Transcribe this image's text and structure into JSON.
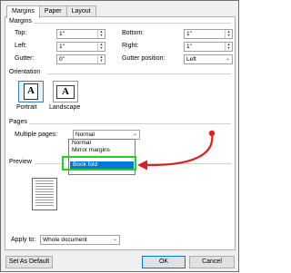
{
  "tabs": [
    {
      "label": "Margins",
      "active": true
    },
    {
      "label": "Paper",
      "active": false
    },
    {
      "label": "Layout",
      "active": false
    }
  ],
  "margins": {
    "section_title": "Margins",
    "top": {
      "label": "Top:",
      "value": "1\""
    },
    "left": {
      "label": "Left:",
      "value": "1\""
    },
    "gutter": {
      "label": "Gutter:",
      "value": "0\""
    },
    "bottom": {
      "label": "Bottom:",
      "value": "1\""
    },
    "right": {
      "label": "Right:",
      "value": "1\""
    },
    "gutter_position": {
      "label": "Gutter position:",
      "value": "Left"
    }
  },
  "orientation": {
    "section_title": "Orientation",
    "portrait": "Portrait",
    "landscape": "Landscape",
    "selected": "Portrait"
  },
  "pages": {
    "section_title": "Pages",
    "multiple_pages_label": "Multiple pages:",
    "multiple_pages_value": "Normal",
    "options": [
      "Normal",
      "Mirror margins",
      "Book fold"
    ],
    "highlighted_option": "Book fold"
  },
  "preview": {
    "section_title": "Preview"
  },
  "apply_to": {
    "label": "Apply to:",
    "value": "Whole document"
  },
  "buttons": {
    "set_as_default": "Set As Default",
    "ok": "OK",
    "cancel": "Cancel"
  },
  "colors": {
    "annotation_arrow": "#e02020",
    "highlight_box": "#22d31f",
    "selection": "#0078d7"
  }
}
